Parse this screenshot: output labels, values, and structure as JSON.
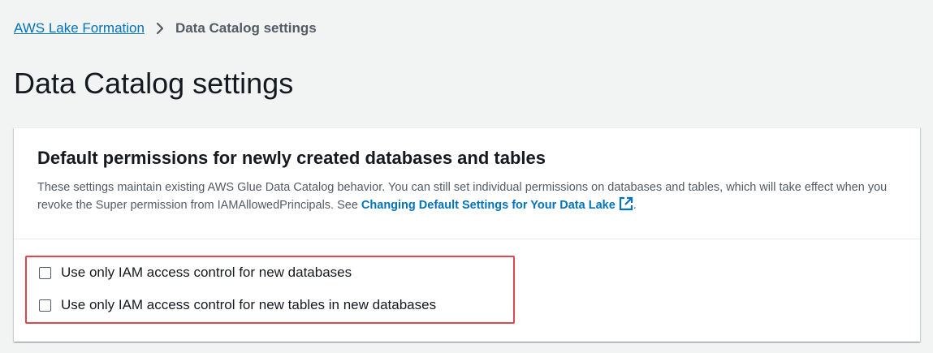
{
  "breadcrumb": {
    "root_label": "AWS Lake Formation",
    "current_label": "Data Catalog settings"
  },
  "page": {
    "title": "Data Catalog settings"
  },
  "panel": {
    "title": "Default permissions for newly created databases and tables",
    "description_text": "These settings maintain existing AWS Glue Data Catalog behavior. You can still set individual permissions on databases and tables, which will take effect when you revoke the Super permission from IAMAllowedPrincipals. See ",
    "link_label": "Changing Default Settings for Your Data Lake",
    "description_end": ".",
    "options": [
      {
        "label": "Use only IAM access control for new databases",
        "checked": false
      },
      {
        "label": "Use only IAM access control for new tables in new databases",
        "checked": false
      }
    ]
  },
  "colors": {
    "link": "#0073bb",
    "highlight_border": "#e0474c",
    "page_background": "#f2f3f3"
  },
  "icons": {
    "breadcrumb_separator": "chevron-right-icon",
    "external_link": "external-link-icon"
  }
}
